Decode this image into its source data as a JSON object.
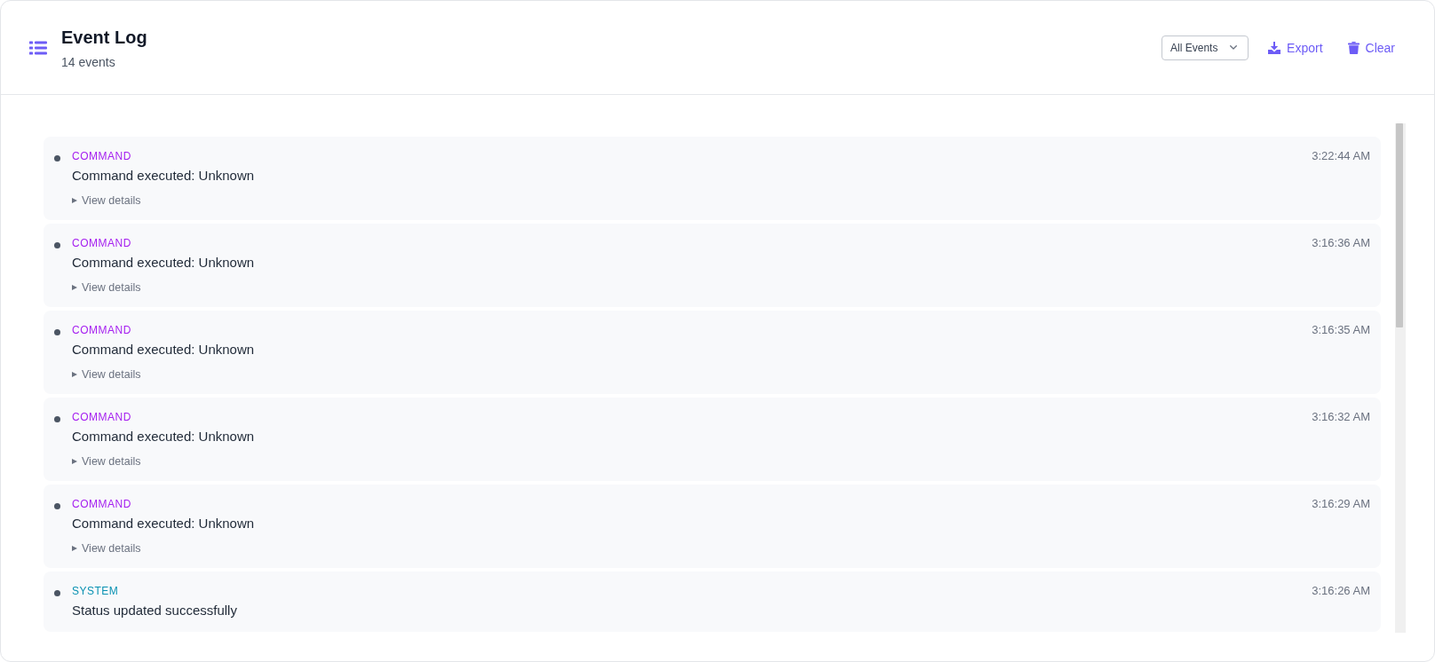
{
  "header": {
    "title": "Event Log",
    "subtitle": "14 events",
    "filter": {
      "value": "All Events"
    },
    "actions": [
      {
        "kind": "export",
        "label": "Export"
      },
      {
        "kind": "clear",
        "label": "Clear"
      }
    ]
  },
  "events": [
    {
      "type": "COMMAND",
      "color": "#a51ff0",
      "message": "Command executed: Unknown",
      "time": "3:22:44 AM",
      "details": {
        "label": "View details",
        "expanded": false
      }
    },
    {
      "type": "COMMAND",
      "color": "#a51ff0",
      "message": "Command executed: Unknown",
      "time": "3:16:36 AM",
      "details": {
        "label": "View details",
        "expanded": false
      }
    },
    {
      "type": "COMMAND",
      "color": "#a51ff0",
      "message": "Command executed: Unknown",
      "time": "3:16:35 AM",
      "details": {
        "label": "View details",
        "expanded": false
      }
    },
    {
      "type": "COMMAND",
      "color": "#a51ff0",
      "message": "Command executed: Unknown",
      "time": "3:16:32 AM",
      "details": {
        "label": "View details",
        "expanded": false
      }
    },
    {
      "type": "COMMAND",
      "color": "#a51ff0",
      "message": "Command executed: Unknown",
      "time": "3:16:29 AM",
      "details": {
        "label": "View details",
        "expanded": false
      }
    },
    {
      "type": "SYSTEM",
      "color": "#0891b2",
      "message": "Status updated successfully",
      "time": "3:16:26 AM"
    }
  ]
}
